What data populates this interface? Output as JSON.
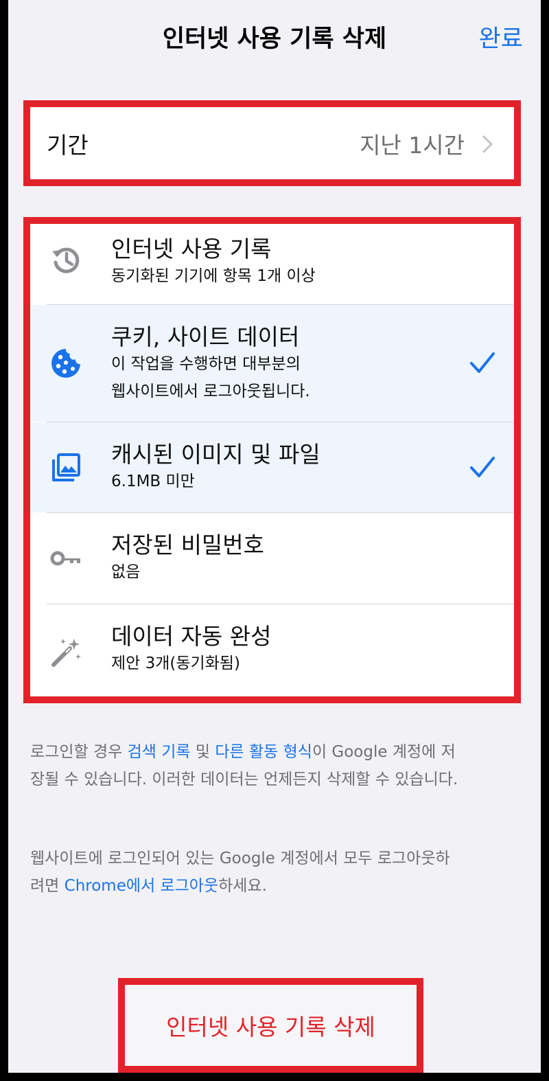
{
  "header": {
    "title": "인터넷 사용 기록 삭제",
    "done_label": "완료"
  },
  "time_range": {
    "label": "기간",
    "value": "지난 1시간"
  },
  "data_types": [
    {
      "title": "인터넷 사용 기록",
      "subtitle": "동기화된 기기에 항목 1개 이상",
      "icon": "history-icon",
      "checked": false
    },
    {
      "title": "쿠키, 사이트 데이터",
      "subtitle_line1": "이 작업을 수행하면 대부분의",
      "subtitle_line2": "웹사이트에서 로그아웃됩니다.",
      "icon": "cookie-icon",
      "checked": true
    },
    {
      "title": "캐시된 이미지 및 파일",
      "subtitle": "6.1MB 미만",
      "icon": "image-icon",
      "checked": true
    },
    {
      "title": "저장된 비밀번호",
      "subtitle": "없음",
      "icon": "key-icon",
      "checked": false
    },
    {
      "title": "데이터 자동 완성",
      "subtitle": "제안 3개(동기화됨)",
      "icon": "magic-wand-icon",
      "checked": false
    }
  ],
  "note1": {
    "prefix": "로그인할 경우 ",
    "link1": "검색 기록",
    "middle": " 및 ",
    "link2": "다른 활동 형식",
    "suffix_line1": "이 Google 계정에 저",
    "line2": "장될 수 있습니다. 이러한 데이터는 언제든지 삭제할 수 있습니다."
  },
  "note2": {
    "line1": "웹사이트에 로그인되어 있는 Google 계정에서 모두 로그아웃하",
    "prefix": "려면 ",
    "link": "Chrome에서 로그아웃",
    "suffix": "하세요."
  },
  "clear_button": {
    "label": "인터넷 사용 기록 삭제"
  },
  "colors": {
    "accent": "#1a73e8",
    "highlight": "#e2222a",
    "selected_row": "#eef5fd",
    "background": "#f2f2f6"
  }
}
